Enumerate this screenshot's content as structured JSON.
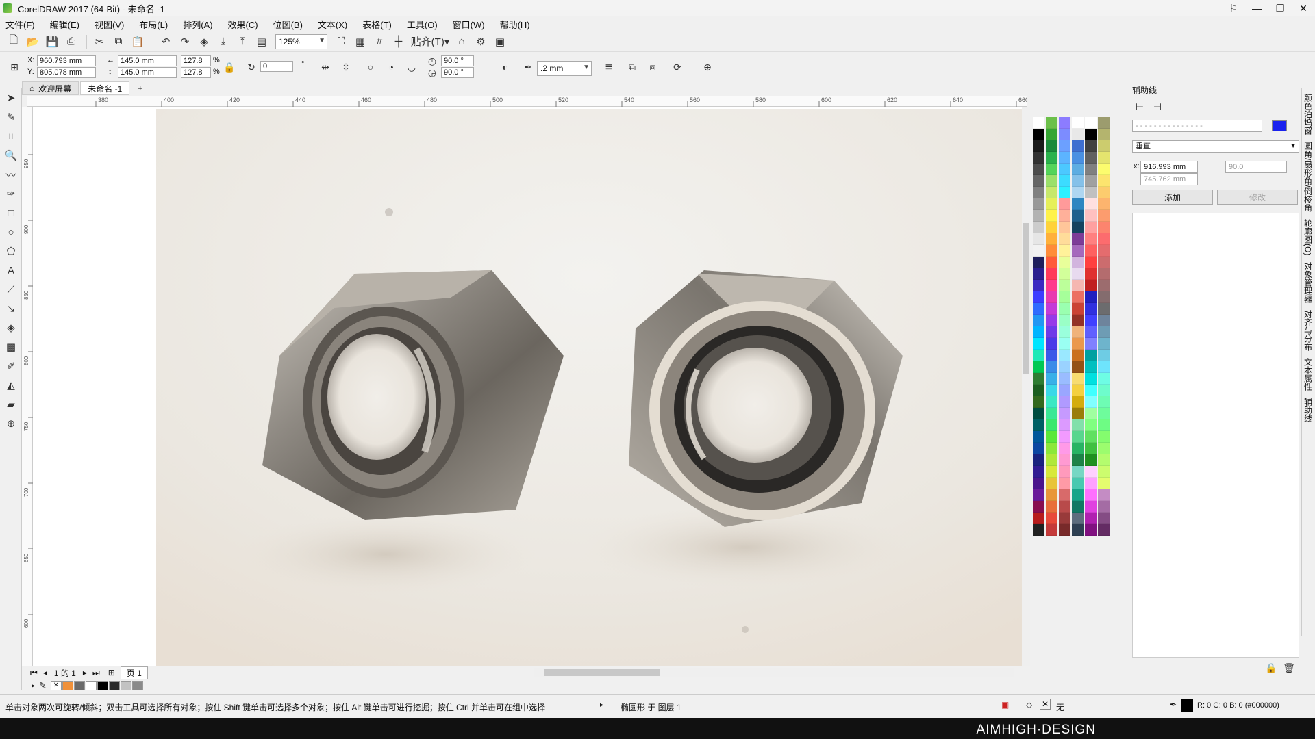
{
  "window": {
    "title": "CorelDRAW 2017 (64-Bit) - 未命名 -1"
  },
  "menu": [
    "文件(F)",
    "编辑(E)",
    "视图(V)",
    "布局(L)",
    "排列(A)",
    "效果(C)",
    "位图(B)",
    "文本(X)",
    "表格(T)",
    "工具(O)",
    "窗口(W)",
    "帮助(H)"
  ],
  "toolbar": {
    "zoom": "125%",
    "snap_label": "贴齐(T)"
  },
  "properties": {
    "x": "960.793 mm",
    "y": "805.078 mm",
    "width": "145.0 mm",
    "height": "145.0 mm",
    "scale_x": "127.8",
    "scale_y": "127.8",
    "percent": "%",
    "rotation": "0",
    "degree_sign": "°",
    "start_angle": "90.0 °",
    "end_angle": "90.0 °",
    "outline": ".2 mm"
  },
  "tabs": {
    "welcome": "欢迎屏幕",
    "document": "未命名 -1"
  },
  "rulers": {
    "h": [
      "380",
      "400",
      "420",
      "440",
      "460",
      "480",
      "500",
      "520",
      "540",
      "560",
      "580",
      "600",
      "620",
      "640",
      "660"
    ],
    "v": [
      "950",
      "900",
      "850",
      "800",
      "750",
      "700",
      "650",
      "600",
      "550",
      "500"
    ]
  },
  "pagebar": {
    "counter": "1 的 1",
    "page_tab": "页 1"
  },
  "docker": {
    "title": "辅助线",
    "orientation": "垂直",
    "x": "916.993 mm",
    "y": "745.762 mm",
    "angle": "90.0",
    "add_label": "添加",
    "modify_label": "修改",
    "guide_color": "#1a22ee"
  },
  "side_tabs": [
    "颜色泊坞窗",
    "圆角/扇形角/倒棱角",
    "轮廓图(O)",
    "对象管理器",
    "对齐与分布",
    "文本属性",
    "辅助线"
  ],
  "status": {
    "hint": "单击对象两次可旋转/倾斜；双击工具可选择所有对象；按住 Shift 键单击可选择多个对象；按住 Alt 键单击可进行挖掘；按住 Ctrl 并单击可在组中选择",
    "object": "椭圆形 于 图层 1",
    "fill": "无",
    "outline_color": "R: 0 G: 0 B: 0 (#000000)"
  },
  "brand": "AIMHIGH·DESIGN",
  "palette_columns": [
    [
      "#ffffff",
      "#000000",
      "#1a1a1a",
      "#333333",
      "#4d4d4d",
      "#666666",
      "#808080",
      "#999999",
      "#b3b3b3",
      "#cccccc",
      "#e6e6e6",
      "#f2f2f2",
      "#1f1f5c",
      "#2b1f8f",
      "#3b29c2",
      "#3d3dff",
      "#2f6bff",
      "#2196f3",
      "#00b4ff",
      "#00e5ff",
      "#1de9b6",
      "#00c853",
      "#2e7d32",
      "#1b5e20",
      "#33691e",
      "#004d40",
      "#006064",
      "#01579b",
      "#0d47a1",
      "#1a237e",
      "#311b92",
      "#4a148c",
      "#6a1b9a",
      "#880e4f",
      "#b71c1c",
      "#212121"
    ],
    [
      "#6cc04a",
      "#35a532",
      "#1b8a3a",
      "#2bb24c",
      "#54d45a",
      "#9be06a",
      "#c7e86b",
      "#e6ef5a",
      "#fff24a",
      "#ffd23a",
      "#ffb03a",
      "#ff8c3a",
      "#ff5a3a",
      "#ff3a5a",
      "#ff3a8c",
      "#e83ab0",
      "#c43ad8",
      "#963ae8",
      "#6e3ae8",
      "#4a3ae8",
      "#3a5ae8",
      "#3a8ce8",
      "#3ab0e8",
      "#3ad8e8",
      "#3ae8c4",
      "#3ae896",
      "#3ae86e",
      "#5ae83a",
      "#8ce83a",
      "#b0e83a",
      "#d8e83a",
      "#e8c43a",
      "#e8963a",
      "#e86e3a",
      "#e84a3a",
      "#c43a3a"
    ],
    [
      "#8c7cff",
      "#7c8cff",
      "#6ca0ff",
      "#5cb4ff",
      "#4cc8ff",
      "#3cdcff",
      "#2cf0ff",
      "#ff9a9a",
      "#ffb09a",
      "#ffc69a",
      "#ffdc9a",
      "#fff29a",
      "#e8ff9a",
      "#d2ff9a",
      "#bcff9a",
      "#a6ff9a",
      "#9affb0",
      "#9affc6",
      "#9affdc",
      "#9afff2",
      "#9ae8ff",
      "#9ad2ff",
      "#9abcff",
      "#9aa6ff",
      "#b09aff",
      "#c69aff",
      "#dc9aff",
      "#f29aff",
      "#ff9ae8",
      "#ff9ad2",
      "#ff9abc",
      "#ff9aa6",
      "#d86a6a",
      "#b84a4a",
      "#983a3a",
      "#782a2a"
    ],
    [
      "#ffffff",
      "#e8e8e8",
      "#3f6fd0",
      "#4a90e2",
      "#5dade2",
      "#85c1e9",
      "#aed6f1",
      "#2e86c1",
      "#1f618d",
      "#154360",
      "#7d3c98",
      "#a569bd",
      "#d2b4de",
      "#e8daef",
      "#f5b7b1",
      "#ec7063",
      "#cb4335",
      "#943126",
      "#f0b27a",
      "#eb984e",
      "#ca6f1e",
      "#935116",
      "#f7dc6f",
      "#f4d03f",
      "#d4ac0d",
      "#9a7d0a",
      "#82e0aa",
      "#58d68d",
      "#28b463",
      "#1d8348",
      "#76d7c4",
      "#48c9b0",
      "#17a589",
      "#117864",
      "#5d6d7e",
      "#2e4053"
    ],
    [
      "#ffffff",
      "#000000",
      "#404040",
      "#606060",
      "#808080",
      "#a0a0a0",
      "#c0c0c0",
      "#ffe0e0",
      "#ffc0c0",
      "#ffa0a0",
      "#ff8080",
      "#ff6060",
      "#ff4040",
      "#e03030",
      "#c02020",
      "#2020c0",
      "#3030e0",
      "#4040ff",
      "#6060ff",
      "#8080ff",
      "#00a0a0",
      "#00c0c0",
      "#00e0e0",
      "#40ffff",
      "#80ffff",
      "#a0ffa0",
      "#80ff80",
      "#60e060",
      "#40c040",
      "#209020",
      "#ffd0ff",
      "#ffa0ff",
      "#ff70ff",
      "#e040e0",
      "#b020b0",
      "#801080"
    ],
    [
      "#9c9c6e",
      "#b4b46e",
      "#cccc6e",
      "#e4e46e",
      "#fcfc6e",
      "#fce46e",
      "#fccc6e",
      "#fcb46e",
      "#fc9c6e",
      "#fc846e",
      "#fc6c6e",
      "#e46c6e",
      "#cc6c6e",
      "#b46c6e",
      "#9c6c6e",
      "#846c6e",
      "#6c6c6e",
      "#6e849c",
      "#6e9cb4",
      "#6eb4cc",
      "#6ecce4",
      "#6ee4fc",
      "#6efce4",
      "#6efccc",
      "#6efcb4",
      "#6efc9c",
      "#6efc84",
      "#84fc6e",
      "#9cfc6e",
      "#b4fc6e",
      "#ccfc6e",
      "#e4fc6e",
      "#c48cc4",
      "#a46ca4",
      "#844c84",
      "#642c64"
    ]
  ]
}
